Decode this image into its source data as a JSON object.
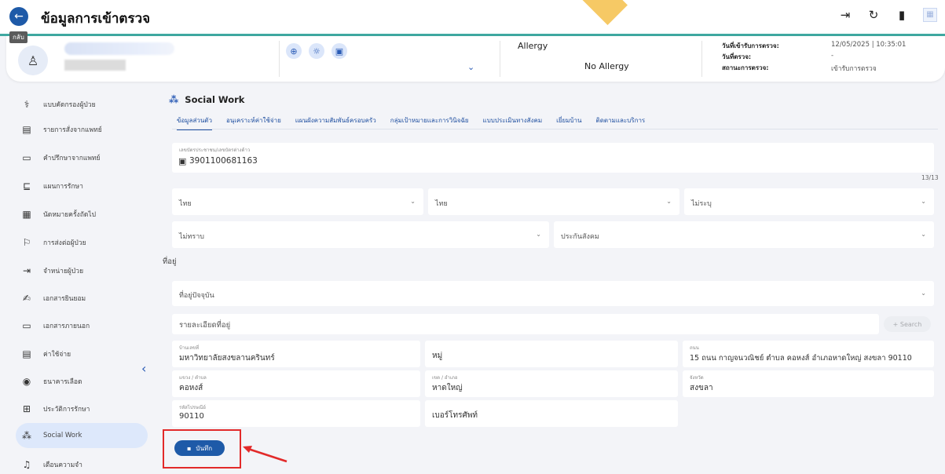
{
  "header": {
    "title": "ข้อมูลการเข้าตรวจ",
    "back_tooltip": "กลับ",
    "actions": [
      "exit-icon",
      "refresh-icon",
      "delete-icon",
      "grid-icon"
    ]
  },
  "patient": {
    "allergy_label": "Allergy",
    "allergy_value": "No Allergy",
    "visit_info": [
      {
        "label": "วันที่เข้ารับการตรวจ:",
        "value": "12/05/2025 | 10:35:01"
      },
      {
        "label": "วันที่ตรวจ:",
        "value": "-"
      },
      {
        "label": "สถานะการตรวจ:",
        "value": "เข้ารับการตรวจ"
      }
    ]
  },
  "sidebar": {
    "items": [
      {
        "label": "แบบคัดกรองผู้ป่วย",
        "icon": "screening-icon"
      },
      {
        "label": "รายการสั่งจากแพทย์",
        "icon": "order-icon"
      },
      {
        "label": "คำปรึกษาจากแพทย์",
        "icon": "consult-icon"
      },
      {
        "label": "แผนการรักษา",
        "icon": "plan-icon"
      },
      {
        "label": "นัดหมายครั้งถัดไป",
        "icon": "calendar-icon"
      },
      {
        "label": "การส่งต่อผู้ป่วย",
        "icon": "transfer-icon"
      },
      {
        "label": "จำหน่ายผู้ป่วย",
        "icon": "discharge-icon"
      },
      {
        "label": "เอกสารยินยอม",
        "icon": "consent-icon"
      },
      {
        "label": "เอกสารภายนอก",
        "icon": "folder-icon"
      },
      {
        "label": "ค่าใช้จ่าย",
        "icon": "bill-icon"
      },
      {
        "label": "ธนาคารเลือด",
        "icon": "blood-icon"
      },
      {
        "label": "ประวัติการรักษา",
        "icon": "history-icon"
      },
      {
        "label": "Social Work",
        "icon": "social-icon",
        "active": true
      },
      {
        "label": "เตือนความจำ",
        "icon": "bell-icon"
      }
    ]
  },
  "main": {
    "section_title": "Social Work",
    "tabs": [
      "ข้อมูลส่วนตัว",
      "อนุเคราะห์ค่าใช้จ่าย",
      "แผนผังความสัมพันธ์ครอบครัว",
      "กลุ่มเป้าหมายและการวินิจฉัย",
      "แบบประเมินทางสังคม",
      "เยี่ยมบ้าน",
      "ติดตามและบริการ"
    ],
    "id_field": {
      "label": "เลขบัตรประชาชน/เลขบัตรต่างด้าว",
      "value": "3901100681163"
    },
    "counter": "13/13",
    "nationality": "ไทย",
    "race": "ไทย",
    "religion": "ไม่ระบุ",
    "unknown": "ไม่ทราบ",
    "insurance": "ประกันสังคม",
    "address_section": "ที่อยู่",
    "current_address": "ที่อยู่ปัจจุบัน",
    "address_detail_placeholder": "รายละเอียดที่อยู่",
    "search_label": "+ Search",
    "house_no": {
      "label": "บ้านเลขที่",
      "value": "มหาวิทยาลัยสงขลานครินทร์"
    },
    "moo": {
      "label": "",
      "value": "หมู่"
    },
    "road": {
      "label": "ถนน",
      "value": "15 ถนน กาญจนวณิชย์ ตำบล คอหงส์ อำเภอหาดใหญ่ สงขลา 90110"
    },
    "subdistrict": {
      "label": "แขวง / ตำบล",
      "value": "คอหงส์"
    },
    "district": {
      "label": "เขต / อำเภอ",
      "value": "หาดใหญ่"
    },
    "province": {
      "label": "จังหวัด",
      "value": "สงขลา"
    },
    "postcode": {
      "label": "รหัสไปรษณีย์",
      "value": "90110"
    },
    "phone_placeholder": "เบอร์โทรศัพท์",
    "save_label": "บันทึก"
  }
}
